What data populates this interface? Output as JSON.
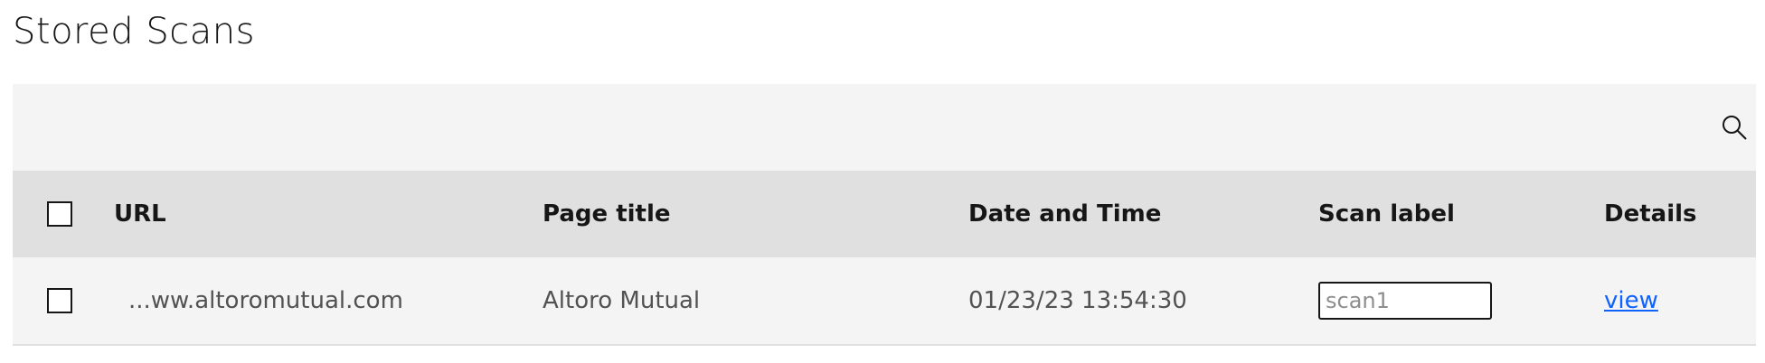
{
  "page": {
    "title": "Stored Scans"
  },
  "table": {
    "columns": {
      "url": "URL",
      "page_title": "Page title",
      "date_time": "Date and Time",
      "scan_label": "Scan label",
      "details": "Details"
    },
    "rows": [
      {
        "url": "...ww.altoromutual.com",
        "page_title": "Altoro Mutual",
        "date_time": "01/23/23 13:54:30",
        "scan_label_value": "scan1",
        "details_link": "view"
      }
    ]
  },
  "colors": {
    "toolbar_bg": "#f4f4f4",
    "header_bg": "#e0e0e0",
    "link": "#0f62fe"
  },
  "icons": {
    "search": "search-icon"
  }
}
